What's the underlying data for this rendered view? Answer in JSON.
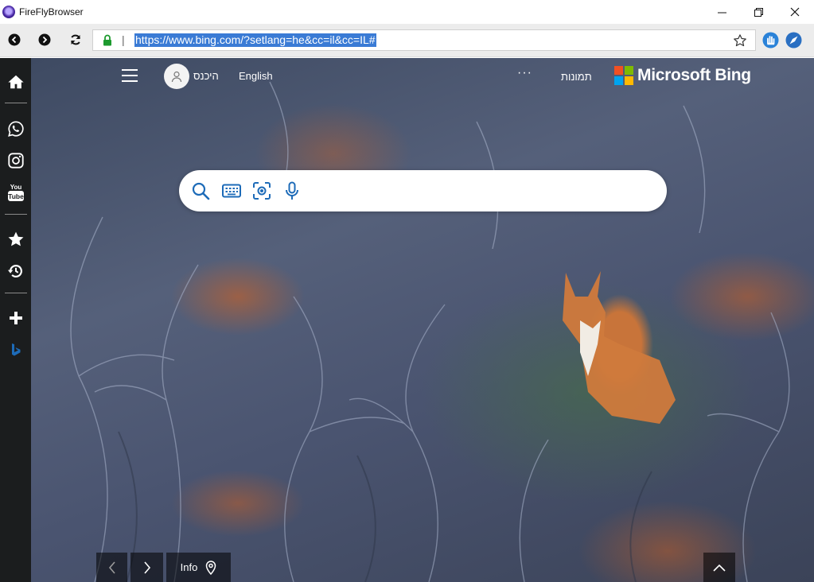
{
  "window": {
    "title": "FireFlyBrowser",
    "minimize_symbol": "—",
    "maximize_symbol": "❐",
    "close_symbol": "✕"
  },
  "toolbar": {
    "url": "https://www.bing.com/?setlang=he&cc=il&cc=IL#",
    "url_separator": "|",
    "icons": [
      "back-icon",
      "forward-icon",
      "reload-icon",
      "lock-icon",
      "bookmark-star-icon",
      "hand-extension-icon",
      "compass-extension-icon"
    ]
  },
  "sidebar": {
    "items": [
      "home-icon",
      "whatsapp-icon",
      "instagram-icon",
      "youtube-icon",
      "favorites-star-icon",
      "history-icon",
      "add-icon",
      "bing-icon"
    ]
  },
  "bing": {
    "brand": "Microsoft Bing",
    "images_link": "תמונות",
    "more_label": "···",
    "language_link": "English",
    "signin_label": "היכנס",
    "search_icons": [
      "search-icon",
      "keyboard-icon",
      "visual-search-icon",
      "microphone-icon"
    ]
  },
  "bottom": {
    "info_label": "Info",
    "prev_symbol": "‹",
    "next_symbol": "›",
    "up_symbol": "︿"
  },
  "colors": {
    "accent": "#3a7bd5",
    "sidebar_bg": "#1b1d1e",
    "toolbar_bg": "#ececec",
    "bing_icon_blue": "#1d6bb8",
    "ms_red": "#f25022",
    "ms_green": "#7fba00",
    "ms_blue": "#00a4ef",
    "ms_yellow": "#ffb900"
  }
}
